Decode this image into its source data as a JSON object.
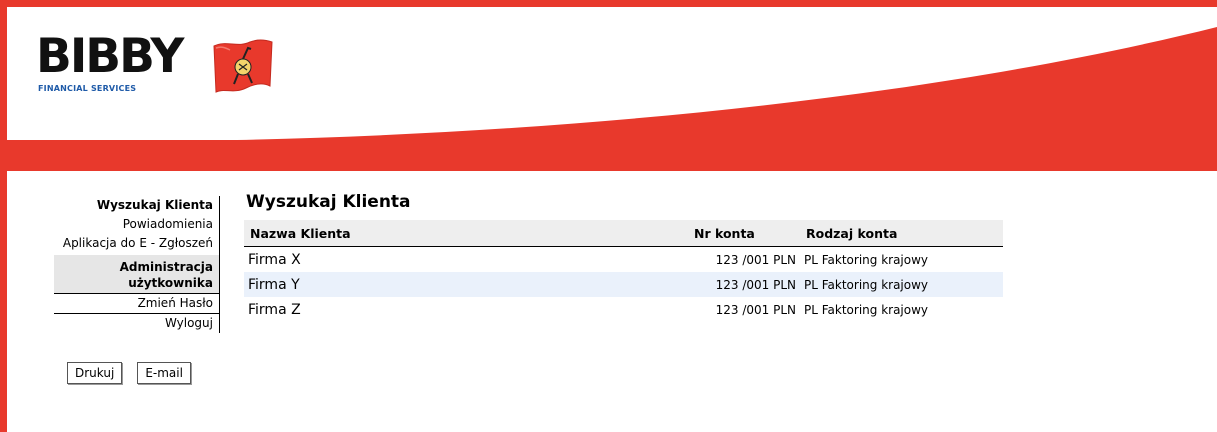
{
  "brand": {
    "logo_name": "BIBBY",
    "logo_subtitle": "FINANCIAL SERVICES",
    "accent_color": "#e8392c"
  },
  "sidebar": {
    "items": [
      {
        "label": "Wyszukaj Klienta"
      },
      {
        "label": "Powiadomienia"
      },
      {
        "label": "Aplikacja do E - Zgłoszeń"
      },
      {
        "label": "Administracja użytkownika"
      },
      {
        "label": "Zmień Hasło"
      },
      {
        "label": "Wyloguj"
      }
    ]
  },
  "actions": {
    "print_label": "Drukuj",
    "email_label": "E-mail"
  },
  "main": {
    "title": "Wyszukaj Klienta",
    "table": {
      "headers": [
        "Nazwa Klienta",
        "Nr konta",
        "Rodzaj konta"
      ],
      "rows": [
        {
          "name": "Firma X",
          "account": "123 /001 PLN",
          "type": "PL Faktoring krajowy"
        },
        {
          "name": "Firma Y",
          "account": "123 /001 PLN",
          "type": "PL Faktoring krajowy"
        },
        {
          "name": "Firma Z",
          "account": "123 /001 PLN",
          "type": "PL Faktoring krajowy"
        }
      ]
    }
  }
}
